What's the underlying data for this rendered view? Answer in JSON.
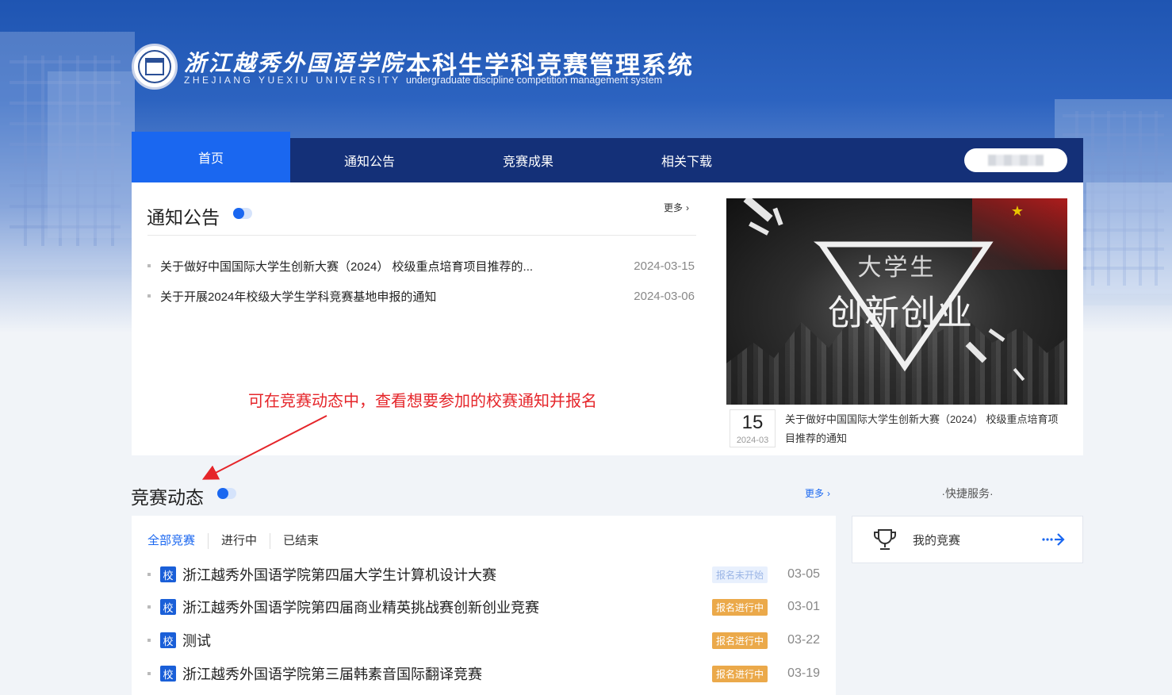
{
  "header": {
    "school_cn": "浙江越秀外国语学院",
    "school_en": "ZHEJIANG YUEXIU UNIVERSITY",
    "system_cn": "本科生学科竞赛管理系统",
    "system_en": "undergraduate discipline competition management system"
  },
  "nav": {
    "items": [
      {
        "label": "首页"
      },
      {
        "label": "通知公告"
      },
      {
        "label": "竞赛成果"
      },
      {
        "label": "相关下载"
      }
    ]
  },
  "notices": {
    "title": "通知公告",
    "more": "更多",
    "items": [
      {
        "title": "关于做好中国国际大学生创新大赛（2024） 校级重点培育项目推荐的...",
        "date": "2024-03-15"
      },
      {
        "title": "关于开展2024年校级大学生学科竞赛基地申报的通知",
        "date": "2024-03-06"
      }
    ]
  },
  "banner": {
    "line1": "大学生",
    "line2": "创新创业",
    "day": "15",
    "year_month": "2024-03",
    "caption": "关于做好中国国际大学生创新大赛（2024） 校级重点培育项目推荐的通知"
  },
  "annotation": "可在竞赛动态中，查看想要参加的校赛通知并报名",
  "competitions": {
    "title": "竞赛动态",
    "more": "更多",
    "filters": [
      "全部竞赛",
      "进行中",
      "已结束"
    ],
    "tag": "校",
    "items": [
      {
        "title": "浙江越秀外国语学院第四届大学生计算机设计大赛",
        "status": "报名未开始",
        "date": "03-05"
      },
      {
        "title": "浙江越秀外国语学院第四届商业精英挑战赛创新创业竞赛",
        "status": "报名进行中",
        "date": "03-01"
      },
      {
        "title": "测试",
        "status": "报名进行中",
        "date": "03-22"
      },
      {
        "title": "浙江越秀外国语学院第三届韩素音国际翻译竞赛",
        "status": "报名进行中",
        "date": "03-19"
      }
    ]
  },
  "quick": {
    "title": "·快捷服务·",
    "card_label": "我的竞赛"
  },
  "colors": {
    "nav_bg": "#143078",
    "accent": "#1a67f0",
    "annotation": "#e5252a",
    "status_ongoing": "#eba94a"
  }
}
